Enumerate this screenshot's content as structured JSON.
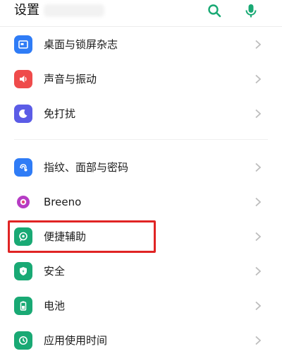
{
  "header": {
    "title": "设置",
    "search_icon": "search-icon",
    "mic_icon": "microphone-icon",
    "accent_color": "#19a974"
  },
  "items": [
    {
      "label": "桌面与锁屏杂志",
      "icon": "wallpaper-icon",
      "color": "#2f7cf6"
    },
    {
      "label": "声音与振动",
      "icon": "speaker-icon",
      "color": "#ef4b4b"
    },
    {
      "label": "免打扰",
      "icon": "moon-icon",
      "color": "#5b5ce6"
    },
    {
      "label": "指纹、面部与密码",
      "icon": "fingerprint-face-icon",
      "color": "#2f7cf6"
    },
    {
      "label": "Breeno",
      "icon": "breeno-icon",
      "color": "#b63cc4"
    },
    {
      "label": "便捷辅助",
      "icon": "assistive-icon",
      "color": "#19a974"
    },
    {
      "label": "安全",
      "icon": "shield-icon",
      "color": "#19a974"
    },
    {
      "label": "电池",
      "icon": "battery-icon",
      "color": "#19a974"
    },
    {
      "label": "应用使用时间",
      "icon": "usage-time-icon",
      "color": "#19a974"
    }
  ],
  "highlight_color": "#e02424"
}
